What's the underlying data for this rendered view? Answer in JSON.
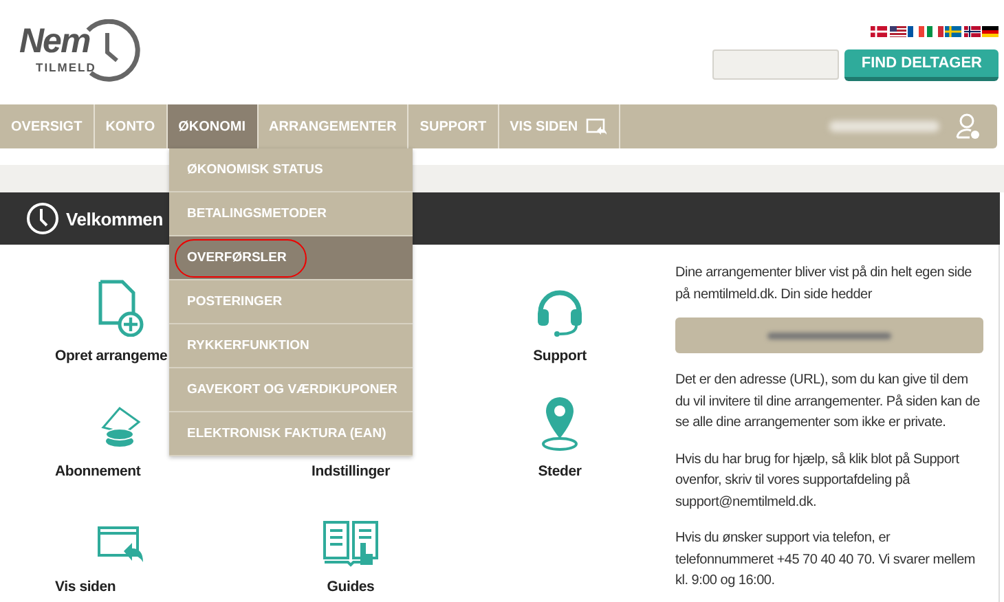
{
  "logo": {
    "word": "Nem",
    "sub": "TILMELD"
  },
  "search": {
    "button": "FIND DELTAGER"
  },
  "nav": [
    {
      "label": "OVERSIGT",
      "selected": false
    },
    {
      "label": "KONTO",
      "selected": false
    },
    {
      "label": "ØKONOMI",
      "selected": true
    },
    {
      "label": "ARRANGEMENTER",
      "selected": false
    },
    {
      "label": "SUPPORT",
      "selected": false
    },
    {
      "label": "VIS SIDEN",
      "selected": false,
      "kind": "with-icon"
    }
  ],
  "dropdown": [
    {
      "label": "ØKONOMISK STATUS",
      "selected": false,
      "circled": false
    },
    {
      "label": "BETALINGSMETODER",
      "selected": false,
      "circled": false
    },
    {
      "label": "OVERFØRSLER",
      "selected": true,
      "circled": true
    },
    {
      "label": "POSTERINGER",
      "selected": false,
      "circled": false
    },
    {
      "label": "RYKKERFUNKTION",
      "selected": false,
      "circled": false
    },
    {
      "label": "GAVEKORT OG VÆRDIKUPONER",
      "selected": false,
      "circled": false
    },
    {
      "label": "ELEKTRONISK FAKTURA (EAN)",
      "selected": false,
      "circled": false
    }
  ],
  "welcome": {
    "title": "Velkommen"
  },
  "tiles": [
    {
      "left": {
        "label": "Opret arrangeme",
        "kind": "document"
      },
      "right": {
        "label": "Support",
        "kind": "headset"
      }
    },
    {
      "left": {
        "label": "Abonnement",
        "kind": "coins"
      },
      "middle": {
        "label": "Indstillinger",
        "kind": "label-only"
      },
      "right": {
        "label": "Steder",
        "kind": "pin"
      }
    },
    {
      "left": {
        "label": "Vis siden",
        "kind": "window"
      },
      "middle": {
        "label": "Guides",
        "kind": "book"
      }
    }
  ],
  "info": {
    "intro": "Dine arrangementer bliver vist på din helt egen side på nemtilmeld.dk. Din side hedder",
    "paragraphs": [
      "Det er den adresse (URL), som du kan give til dem du vil invitere til dine arrangementer. På siden kan de se alle dine arrangementer som ikke er private.",
      "Hvis du har brug for hjælp, så klik blot på Support ovenfor, skriv til vores supportafdeling på support@nemtilmeld.dk.",
      "Hvis du ønsker support via telefon, er telefonnummeret +45 70 40 40 70. Vi svarer mellem kl. 9:00 og 16:00."
    ]
  }
}
